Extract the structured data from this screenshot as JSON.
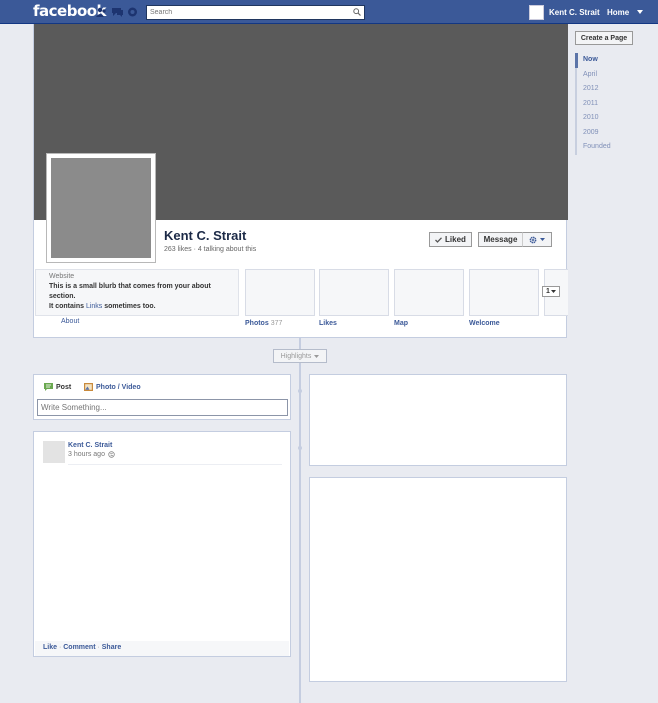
{
  "topbar": {
    "logo": "facebook",
    "search_placeholder": "Search",
    "user_name": "Kent C. Strait",
    "home_label": "Home",
    "icons": [
      "friend-requests-icon",
      "messages-icon",
      "notifications-icon",
      "search-icon",
      "caret-down-icon"
    ]
  },
  "profile": {
    "name": "Kent C. Strait",
    "meta": "263 likes · 4 talking about this",
    "liked_label": "Liked",
    "message_label": "Message",
    "about": {
      "label": "Website",
      "blurb": "This is a small blurb that comes from your about section.",
      "links_prefix": "It contains ",
      "links_word": "Links",
      "links_suffix": " sometimes too.",
      "about_link": "About"
    },
    "apps": [
      {
        "label": "Photos",
        "count": "377"
      },
      {
        "label": "Likes",
        "count": ""
      },
      {
        "label": "Map",
        "count": ""
      },
      {
        "label": "Welcome",
        "count": ""
      }
    ],
    "more_label": "1"
  },
  "sidebar": {
    "create_page_label": "Create a Page",
    "years": [
      "Now",
      "April",
      "2012",
      "2011",
      "2010",
      "2009",
      "Founded"
    ],
    "active_index": 0
  },
  "timeline": {
    "highlights_label": "Highlights",
    "composer": {
      "post_label": "Post",
      "photo_label": "Photo / Video",
      "placeholder": "Write Something..."
    },
    "story": {
      "author": "Kent C. Strait",
      "time": "3 hours ago",
      "like_label": "Like",
      "comment_label": "Comment",
      "share_label": "Share"
    }
  },
  "colors": {
    "brand_blue": "#3b5998",
    "page_bg": "#e9ebf1",
    "cover_gray": "#5a5a5a",
    "link": "#3b5998"
  }
}
